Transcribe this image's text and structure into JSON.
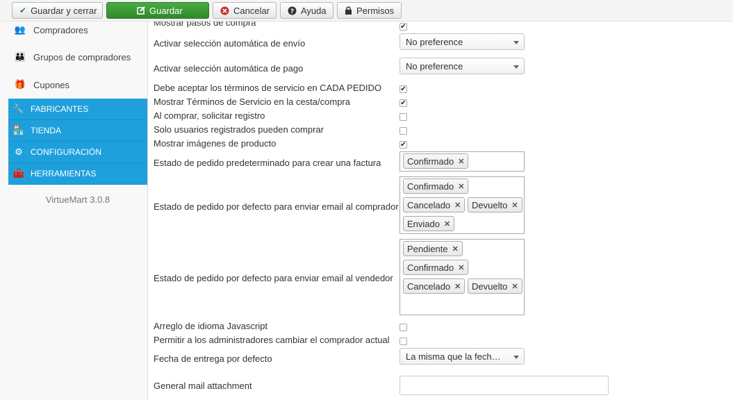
{
  "toolbar": {
    "save_close": "Guardar y cerrar",
    "save": "Guardar",
    "cancel": "Cancelar",
    "help": "Ayuda",
    "permissions": "Permisos"
  },
  "sidebar": {
    "items": [
      {
        "label": "Compradores",
        "icon": "users-icon"
      },
      {
        "label": "Grupos de compradores",
        "icon": "user-groups-icon"
      },
      {
        "label": "Cupones",
        "icon": "gift-icon"
      }
    ],
    "sections": [
      {
        "label": "FABRICANTES",
        "icon": "wrench-icon"
      },
      {
        "label": "TIENDA",
        "icon": "store-icon"
      },
      {
        "label": "CONFIGURACIÓN",
        "icon": "gear-icon"
      },
      {
        "label": "HERRAMIENTAS",
        "icon": "tools-box-icon"
      }
    ],
    "version": "VirtueMart 3.0.8"
  },
  "form": {
    "partial_top_label": "Mostrar pasos de compra",
    "ship_auto_label": "Activar selección automática de envío",
    "ship_auto_value": "No preference",
    "pay_auto_label": "Activar selección automática de pago",
    "pay_auto_value": "No preference",
    "tos_each_label": "Debe aceptar los términos de servicio en CADA PEDIDO",
    "tos_show_label": "Mostrar Términos de Servicio en la cesta/compra",
    "ask_register_label": "Al comprar, solicitar registro",
    "only_registered_label": "Solo usuarios registrados pueden comprar",
    "show_images_label": "Mostrar imágenes de producto",
    "invoice_status_label": "Estado de pedido predeterminado para crear una factura",
    "invoice_status_chips": [
      "Confirmado"
    ],
    "email_buyer_label": "Estado de pedido por defecto para enviar email al comprador",
    "email_buyer_chips": [
      "Confirmado",
      "Cancelado",
      "Devuelto",
      "Enviado"
    ],
    "email_vendor_label": "Estado de pedido por defecto para enviar email al vendedor",
    "email_vendor_chips": [
      "Pendiente",
      "Confirmado",
      "Cancelado",
      "Devuelto"
    ],
    "js_lang_label": "Arreglo de idioma Javascript",
    "admin_change_label": "Permitir a los administradores cambiar el comprador actual",
    "delivery_date_label": "Fecha de entrega por defecto",
    "delivery_date_value": "La misma que la fech…",
    "mail_attach_label": "General mail attachment",
    "mail_attach_value": ""
  },
  "checkboxes": {
    "partial_top": true,
    "tos_each": true,
    "tos_show": true,
    "ask_register": false,
    "only_registered": false,
    "show_images": true,
    "js_lang": false,
    "admin_change": false
  },
  "colors": {
    "accent_blue": "#1ea0dc",
    "save_green": "#3a9a34"
  }
}
